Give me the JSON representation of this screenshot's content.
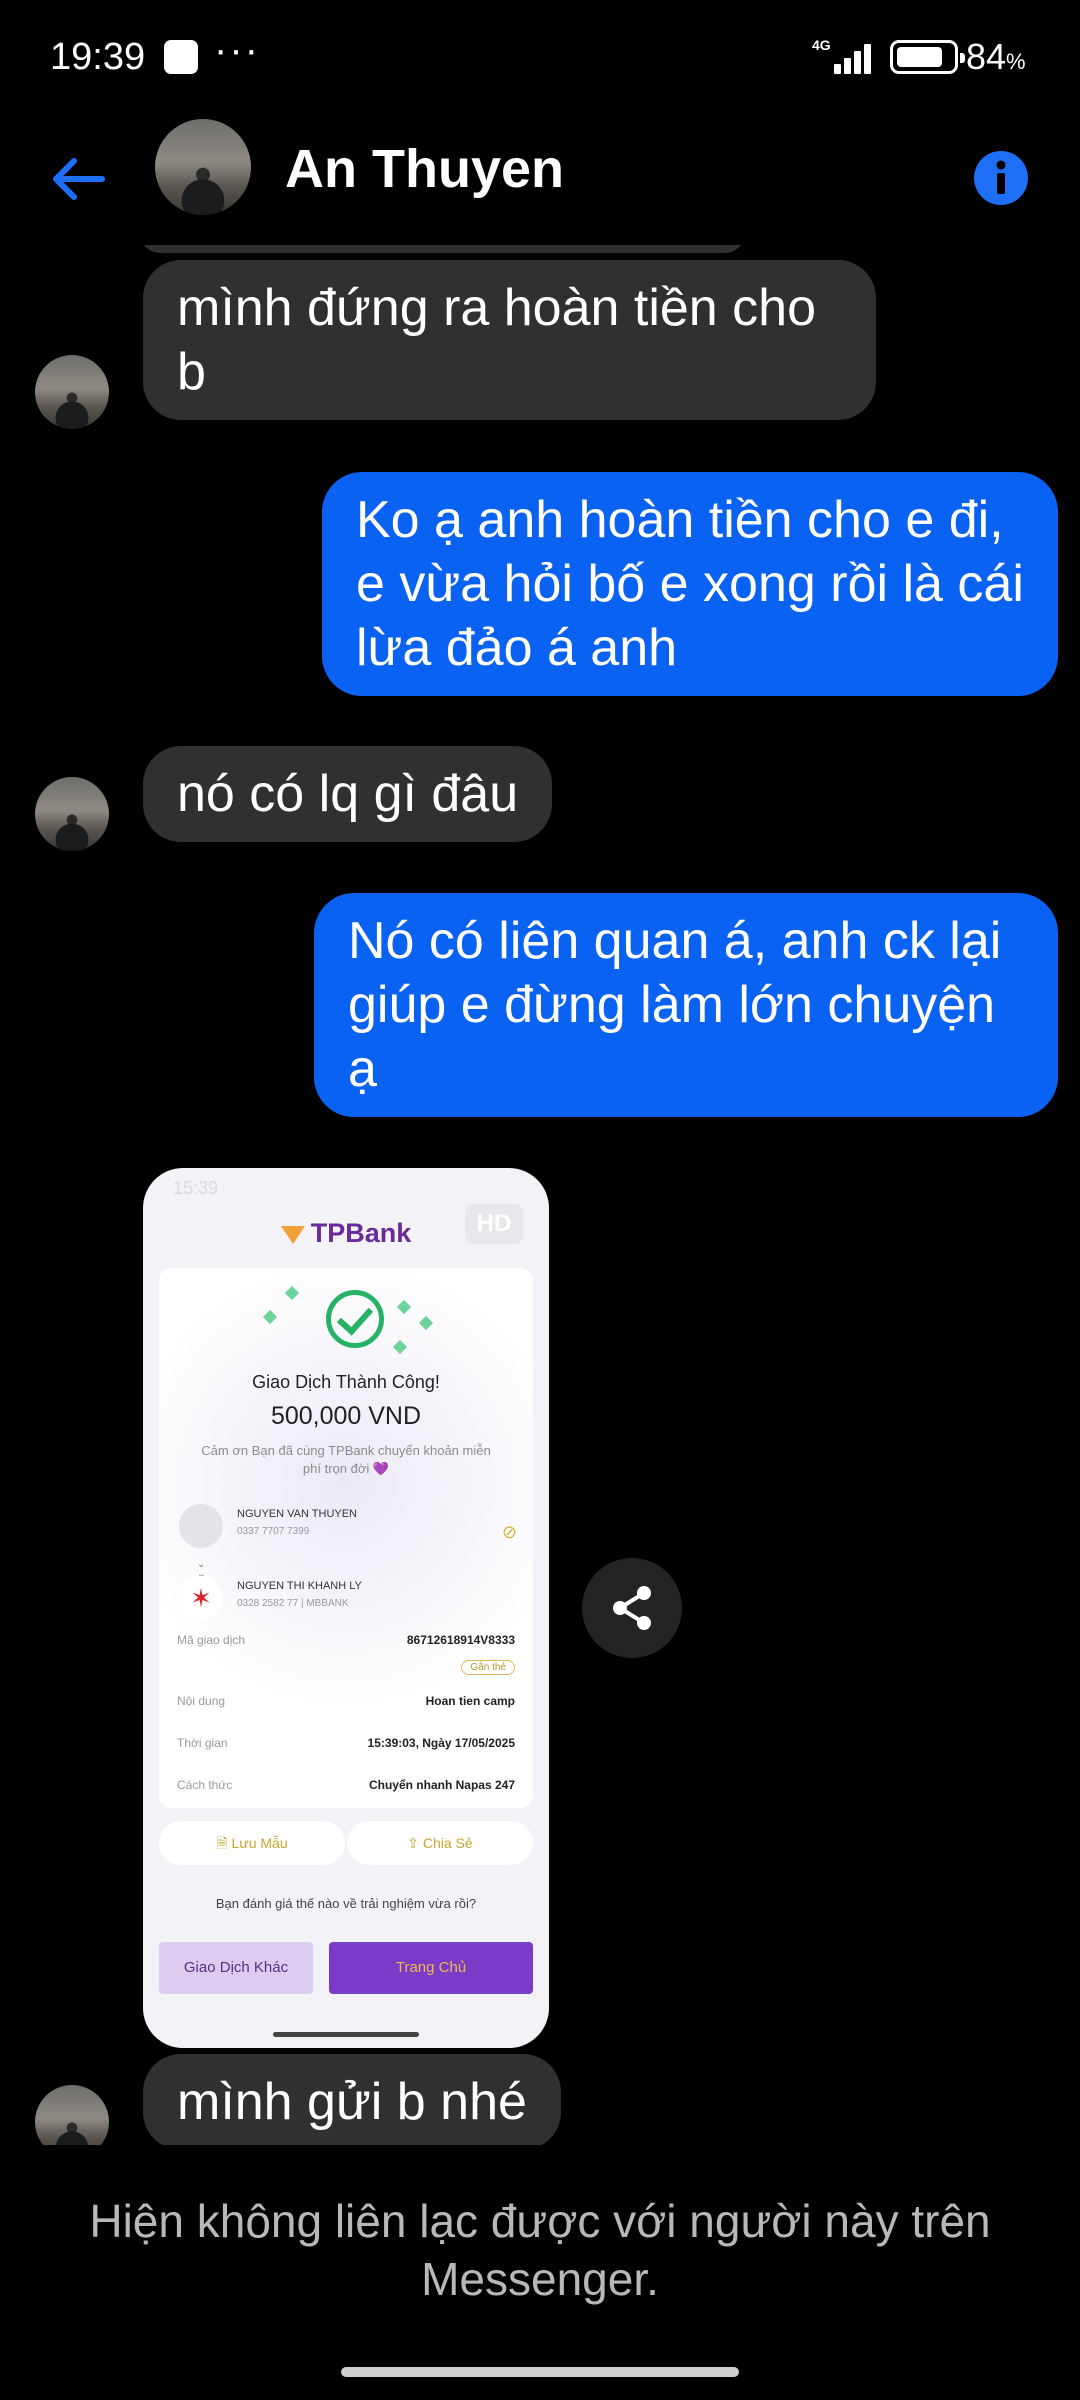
{
  "status_bar": {
    "time": "19:39",
    "more": "···",
    "network": "4G",
    "battery_percent": "84",
    "battery_unit": "%",
    "battery_level": 0.84
  },
  "header": {
    "contact_name": "An Thuyen",
    "back_icon": "arrow-left-icon",
    "info_icon": "info-icon",
    "accent_color": "#0a62f3"
  },
  "messages": [
    {
      "direction": "incoming",
      "text": "mình đứng ra hoàn tiền cho b"
    },
    {
      "direction": "outgoing",
      "text": "Ko ạ anh hoàn tiền cho e đi, e vừa hỏi bố e xong rồi là cái lừa đảo á anh"
    },
    {
      "direction": "incoming",
      "text": "nó có lq gì đâu"
    },
    {
      "direction": "outgoing",
      "text": "Nó có liên quan á, anh ck lại giúp e đừng làm lớn chuyện ạ"
    },
    {
      "direction": "incoming",
      "text": "mình gửi b nhé"
    }
  ],
  "receipt_image": {
    "status_time": "15:39",
    "hd_badge": "HD",
    "bank_logo": "TPBank",
    "title": "Giao Dịch Thành Công!",
    "amount": "500,000 VND",
    "note": "Cảm ơn Bạn đã cùng TPBank chuyển khoản miễn phí trọn đời 💜",
    "sender_name": "NGUYEN VAN THUYEN",
    "sender_account": "0337 7707 7399",
    "receiver_name": "NGUYEN THI KHANH LY",
    "receiver_account": "0328 2582 77 | MBBANK",
    "rows": [
      {
        "label": "Mã giao dịch",
        "value": "86712618914V8333"
      },
      {
        "label": "Nội dung",
        "value": "Hoan tien camp"
      },
      {
        "label": "Thời gian",
        "value": "15:39:03, Ngày 17/05/2025"
      },
      {
        "label": "Cách thức",
        "value": "Chuyển nhanh Napas 247"
      }
    ],
    "tag": "Gắn thẻ",
    "save_label": "Lưu Mẫu",
    "share_label": "Chia Sẻ",
    "rating_question": "Bạn đánh giá thế nào về trải nghiệm vừa rồi?",
    "other_tx_label": "Giao Dịch Khác",
    "home_label": "Trang Chủ"
  },
  "share_icon": "share-icon",
  "footer": {
    "unavailable_text": "Hiện không liên lạc được với người này trên Messenger."
  }
}
